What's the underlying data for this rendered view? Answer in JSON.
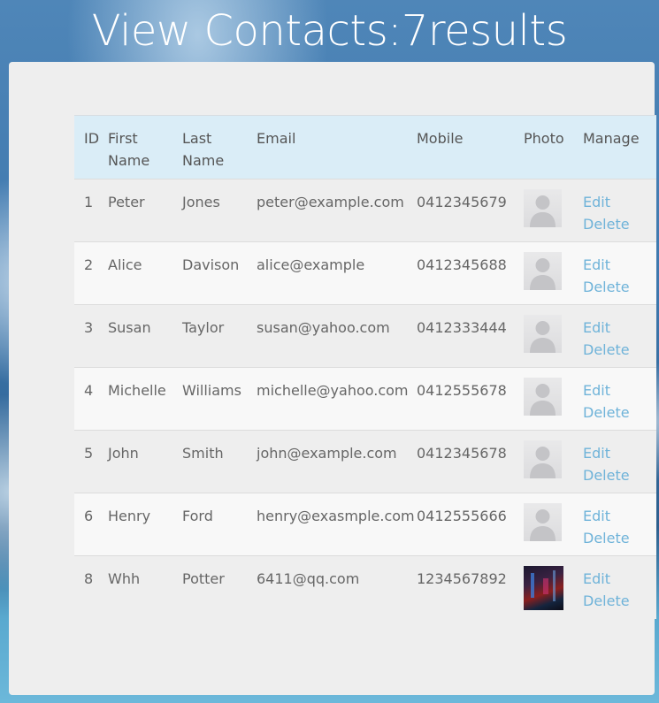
{
  "page": {
    "title": "View Contacts:7results"
  },
  "table": {
    "headers": {
      "id": "ID",
      "first_name": "First Name",
      "last_name": "Last Name",
      "email": "Email",
      "mobile": "Mobile",
      "photo": "Photo",
      "manage": "Manage"
    },
    "rows": [
      {
        "id": "1",
        "first_name": "Peter",
        "last_name": "Jones",
        "email": "peter@example.com",
        "mobile": "0412345679",
        "photo": "default-avatar-icon",
        "edit": "Edit",
        "delete": "Delete"
      },
      {
        "id": "2",
        "first_name": "Alice",
        "last_name": "Davison",
        "email": "alice@example",
        "mobile": "0412345688",
        "photo": "default-avatar-icon",
        "edit": "Edit",
        "delete": "Delete"
      },
      {
        "id": "3",
        "first_name": "Susan",
        "last_name": "Taylor",
        "email": "susan@yahoo.com",
        "mobile": "0412333444",
        "photo": "default-avatar-icon",
        "edit": "Edit",
        "delete": "Delete"
      },
      {
        "id": "4",
        "first_name": "Michelle",
        "last_name": "Williams",
        "email": "michelle@yahoo.com",
        "mobile": "0412555678",
        "photo": "default-avatar-icon",
        "edit": "Edit",
        "delete": "Delete"
      },
      {
        "id": "5",
        "first_name": "John",
        "last_name": "Smith",
        "email": "john@example.com",
        "mobile": "0412345678",
        "photo": "default-avatar-icon",
        "edit": "Edit",
        "delete": "Delete"
      },
      {
        "id": "6",
        "first_name": "Henry",
        "last_name": "Ford",
        "email": "henry@exasmple.com",
        "mobile": "0412555666",
        "photo": "default-avatar-icon",
        "edit": "Edit",
        "delete": "Delete"
      },
      {
        "id": "8",
        "first_name": "Whh",
        "last_name": "Potter",
        "email": "6411@qq.com",
        "mobile": "1234567892",
        "photo": "contact-photo-image",
        "edit": "Edit",
        "delete": "Delete"
      }
    ]
  },
  "colors": {
    "header_bg": "#daedf7",
    "link": "#6fb3d9",
    "panel_bg": "#eeeeee",
    "title_text": "#ffffff"
  }
}
